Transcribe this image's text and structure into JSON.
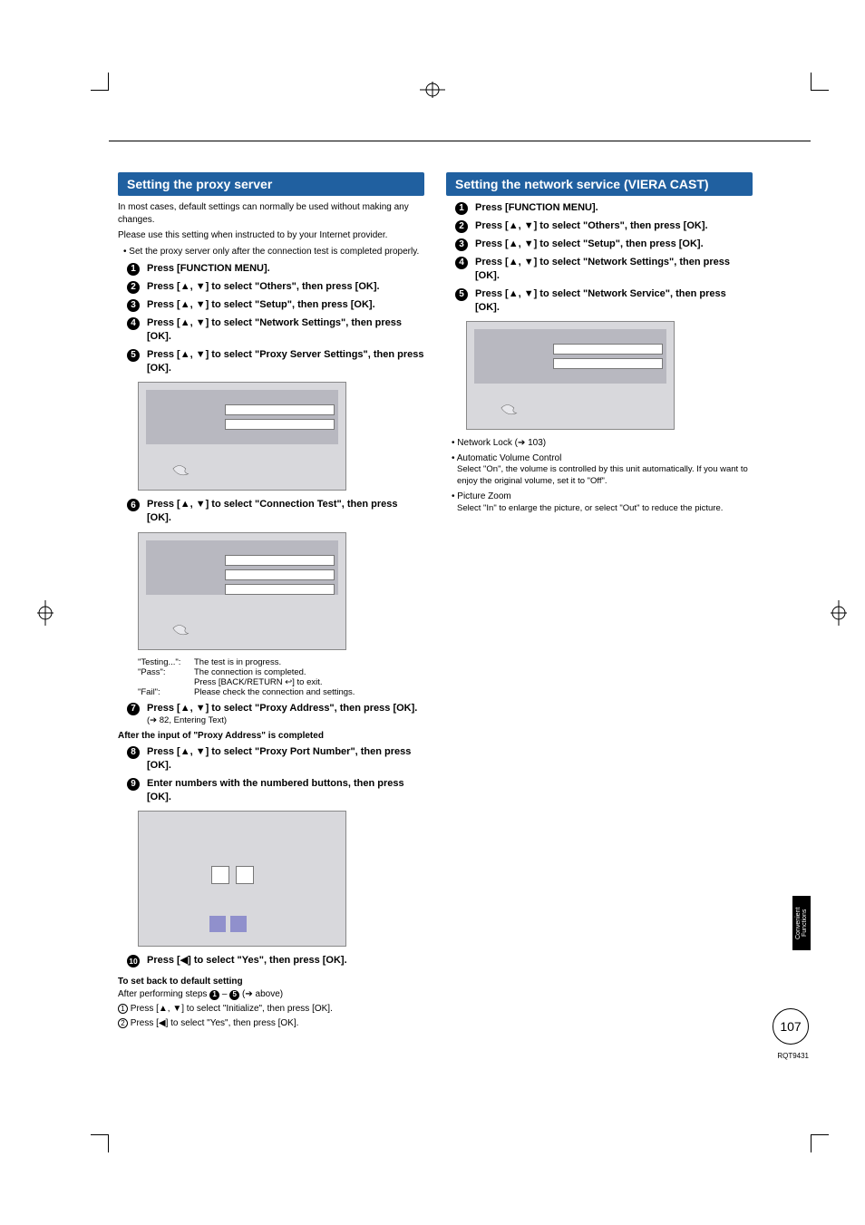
{
  "left": {
    "header": "Setting the proxy server",
    "intro1": "In most cases, default settings can normally be used without making any changes.",
    "intro2": "Please use this setting when instructed to by your Internet provider.",
    "introBullet": "• Set the proxy server only after the connection test is completed properly.",
    "steps": [
      "Press [FUNCTION MENU].",
      "Press [▲, ▼] to select \"Others\", then press [OK].",
      "Press [▲, ▼] to select \"Setup\", then press [OK].",
      "Press [▲, ▼] to select \"Network Settings\", then press [OK].",
      "Press [▲, ▼] to select \"Proxy Server Settings\", then press [OK].",
      "Press [▲, ▼] to select \"Connection Test\", then press [OK].",
      "Press [▲, ▼] to select \"Proxy Address\", then press [OK].",
      "Press [▲, ▼] to select \"Proxy Port Number\", then press [OK].",
      "Enter numbers with the numbered buttons, then press [OK].",
      "Press [◀] to select \"Yes\", then press [OK]."
    ],
    "connTable": {
      "testing_k": "\"Testing...\":",
      "testing_v": "The test is in progress.",
      "pass_k": "\"Pass\":",
      "pass_v": "The connection is completed.",
      "pass_v2": "Press [BACK/RETURN ↩] to exit.",
      "fail_k": "\"Fail\":",
      "fail_v": "Please check the connection and settings."
    },
    "subNote7": "(➔ 82, Entering Text)",
    "afterHead": "After the input of \"Proxy Address\" is completed",
    "defBackHead": "To set back to default setting",
    "defBack1a": "After performing steps ",
    "defBack1b": " – ",
    "defBack1c": " (➔ above)",
    "defBack2a": " Press [▲, ▼] to select \"Initialize\", then press [OK].",
    "defBack3a": " Press [◀] to select \"Yes\", then press [OK]."
  },
  "right": {
    "header": "Setting the network service (VIERA CAST)",
    "steps": [
      "Press [FUNCTION MENU].",
      "Press [▲, ▼] to select \"Others\", then press [OK].",
      "Press [▲, ▼] to select \"Setup\", then press [OK].",
      "Press [▲, ▼] to select \"Network Settings\", then press [OK].",
      "Press [▲, ▼] to select \"Network Service\", then press [OK]."
    ],
    "notes": {
      "lock": "• Network Lock (➔ 103)",
      "avc": "• Automatic Volume Control",
      "avc_d": "Select \"On\", the volume is controlled by this unit automatically. If you want to enjoy the original volume, set it to \"Off\".",
      "zoom": "• Picture Zoom",
      "zoom_d": "Select \"In\" to enlarge the picture, or select  \"Out\" to reduce the picture."
    }
  },
  "sideTab": "Convenient Functions",
  "pageNum": "107",
  "docId": "RQT9431"
}
